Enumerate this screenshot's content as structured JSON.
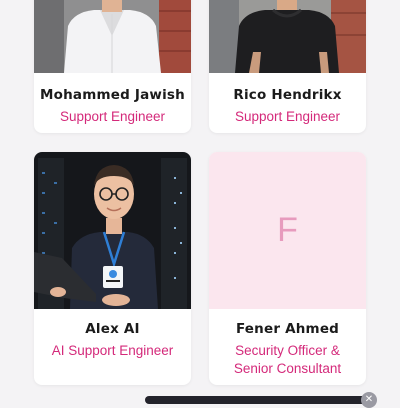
{
  "team": {
    "members": [
      {
        "name": "Mohammed Jawish",
        "role": "Support Engineer"
      },
      {
        "name": "Rico Hendrikx",
        "role": "Support Engineer"
      },
      {
        "name": "Alex AI",
        "role": "AI Support Engineer"
      },
      {
        "name": "Fener Ahmed",
        "role_line1": "Security Officer &",
        "role_line2": "Senior Consultant",
        "initial": "F"
      }
    ]
  },
  "overlay": {
    "close_label": "✕"
  },
  "colors": {
    "accent": "#d4297a",
    "name_text": "#1b1b1b",
    "placeholder_bg": "#fbe6ee",
    "placeholder_initial": "#e79bbd",
    "page_bg": "#f4f3f5"
  }
}
